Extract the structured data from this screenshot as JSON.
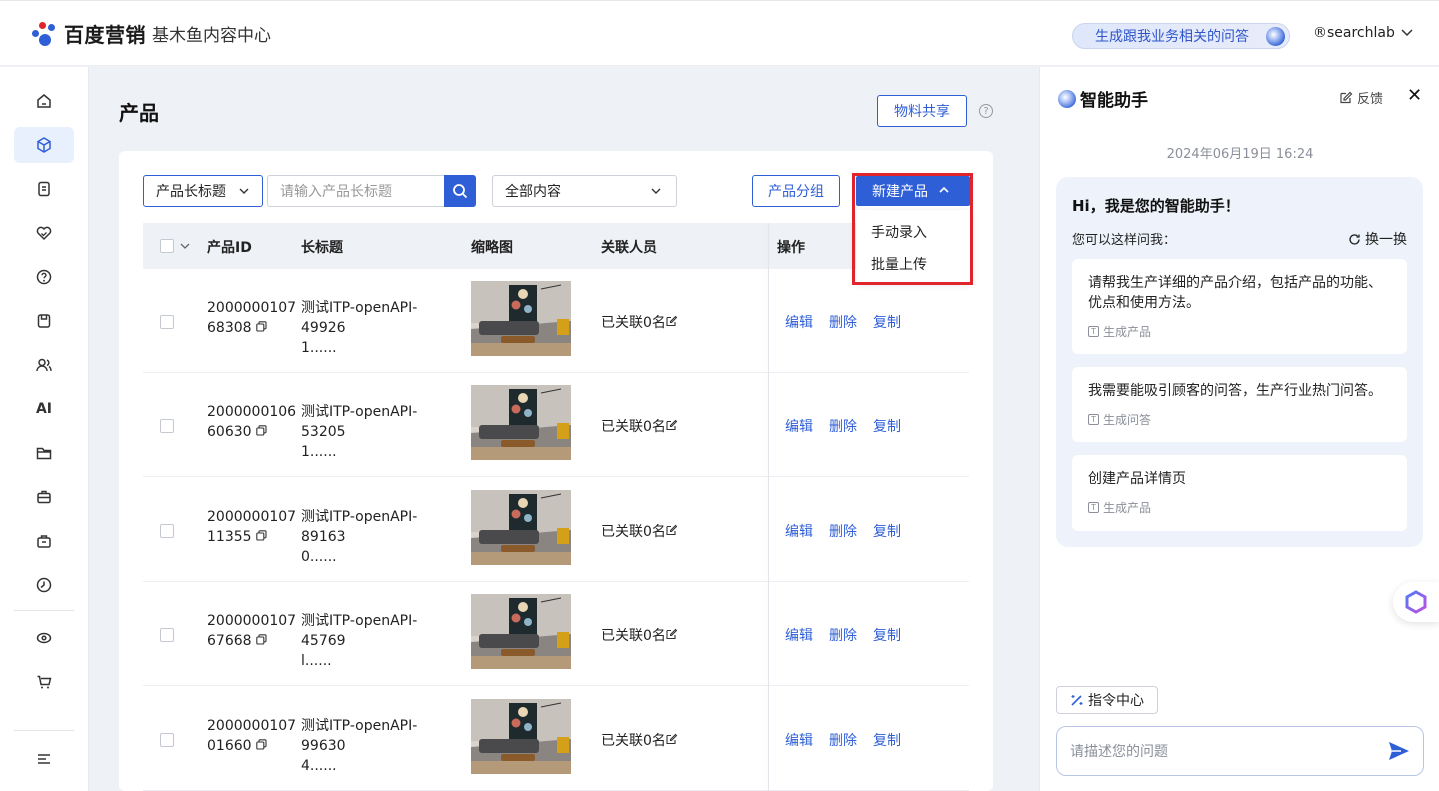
{
  "header": {
    "brand": "百度营销",
    "product": "基木鱼内容中心",
    "ai_pill": "生成跟我业务相关的问答",
    "user": "®searchlab"
  },
  "page": {
    "title": "产品",
    "share_button": "物料共享",
    "help": "?"
  },
  "filters": {
    "field_select": "产品长标题",
    "search_placeholder": "请输入产品长标题",
    "content_select": "全部内容",
    "group_button": "产品分组",
    "new_button": "新建产品",
    "new_menu": [
      "手动录入",
      "批量上传"
    ]
  },
  "table": {
    "columns": [
      "产品ID",
      "长标题",
      "缩略图",
      "关联人员",
      "操作"
    ],
    "rows": [
      {
        "id_line1": "2000000107",
        "id_line2": "68308",
        "title_line1": "测试ITP-openAPI-49926",
        "title_line2": "1......",
        "people": "已关联0名"
      },
      {
        "id_line1": "2000000106",
        "id_line2": "60630",
        "title_line1": "测试ITP-openAPI-53205",
        "title_line2": "1......",
        "people": "已关联0名"
      },
      {
        "id_line1": "2000000107",
        "id_line2": "11355",
        "title_line1": "测试ITP-openAPI-89163",
        "title_line2": "0......",
        "people": "已关联0名"
      },
      {
        "id_line1": "2000000107",
        "id_line2": "67668",
        "title_line1": "测试ITP-openAPI-45769",
        "title_line2": "l......",
        "people": "已关联0名"
      },
      {
        "id_line1": "2000000107",
        "id_line2": "01660",
        "title_line1": "测试ITP-openAPI-99630",
        "title_line2": "4......",
        "people": "已关联0名"
      }
    ],
    "actions": [
      "编辑",
      "删除",
      "复制"
    ]
  },
  "assistant": {
    "title": "智能助手",
    "feedback": "反馈",
    "close": "✕",
    "timestamp": "2024年06月19日 16:24",
    "greeting": "Hi，我是您的智能助手！",
    "ask_hint": "您可以这样问我：",
    "swap": "换一换",
    "suggestions": [
      {
        "text": "请帮我生产详细的产品介绍，包括产品的功能、优点和使用方法。",
        "tag": "生成产品"
      },
      {
        "text": "我需要能吸引顾客的问答，生产行业热门问答。",
        "tag": "生成问答"
      },
      {
        "text": "创建产品详情页",
        "tag": "生成产品"
      }
    ],
    "command_center": "指令中心",
    "input_placeholder": "请描述您的问题"
  },
  "colors": {
    "accent": "#2f5fd6",
    "highlight": "#e0242b"
  },
  "icons": [
    "home-icon",
    "cube-icon",
    "document-icon",
    "heart-icon",
    "question-icon",
    "save-icon",
    "users-icon",
    "ai-icon",
    "folder-icon",
    "briefcase-icon",
    "toolbox-icon",
    "clock-icon",
    "eye-icon",
    "cart-icon",
    "menu-collapse-icon"
  ]
}
